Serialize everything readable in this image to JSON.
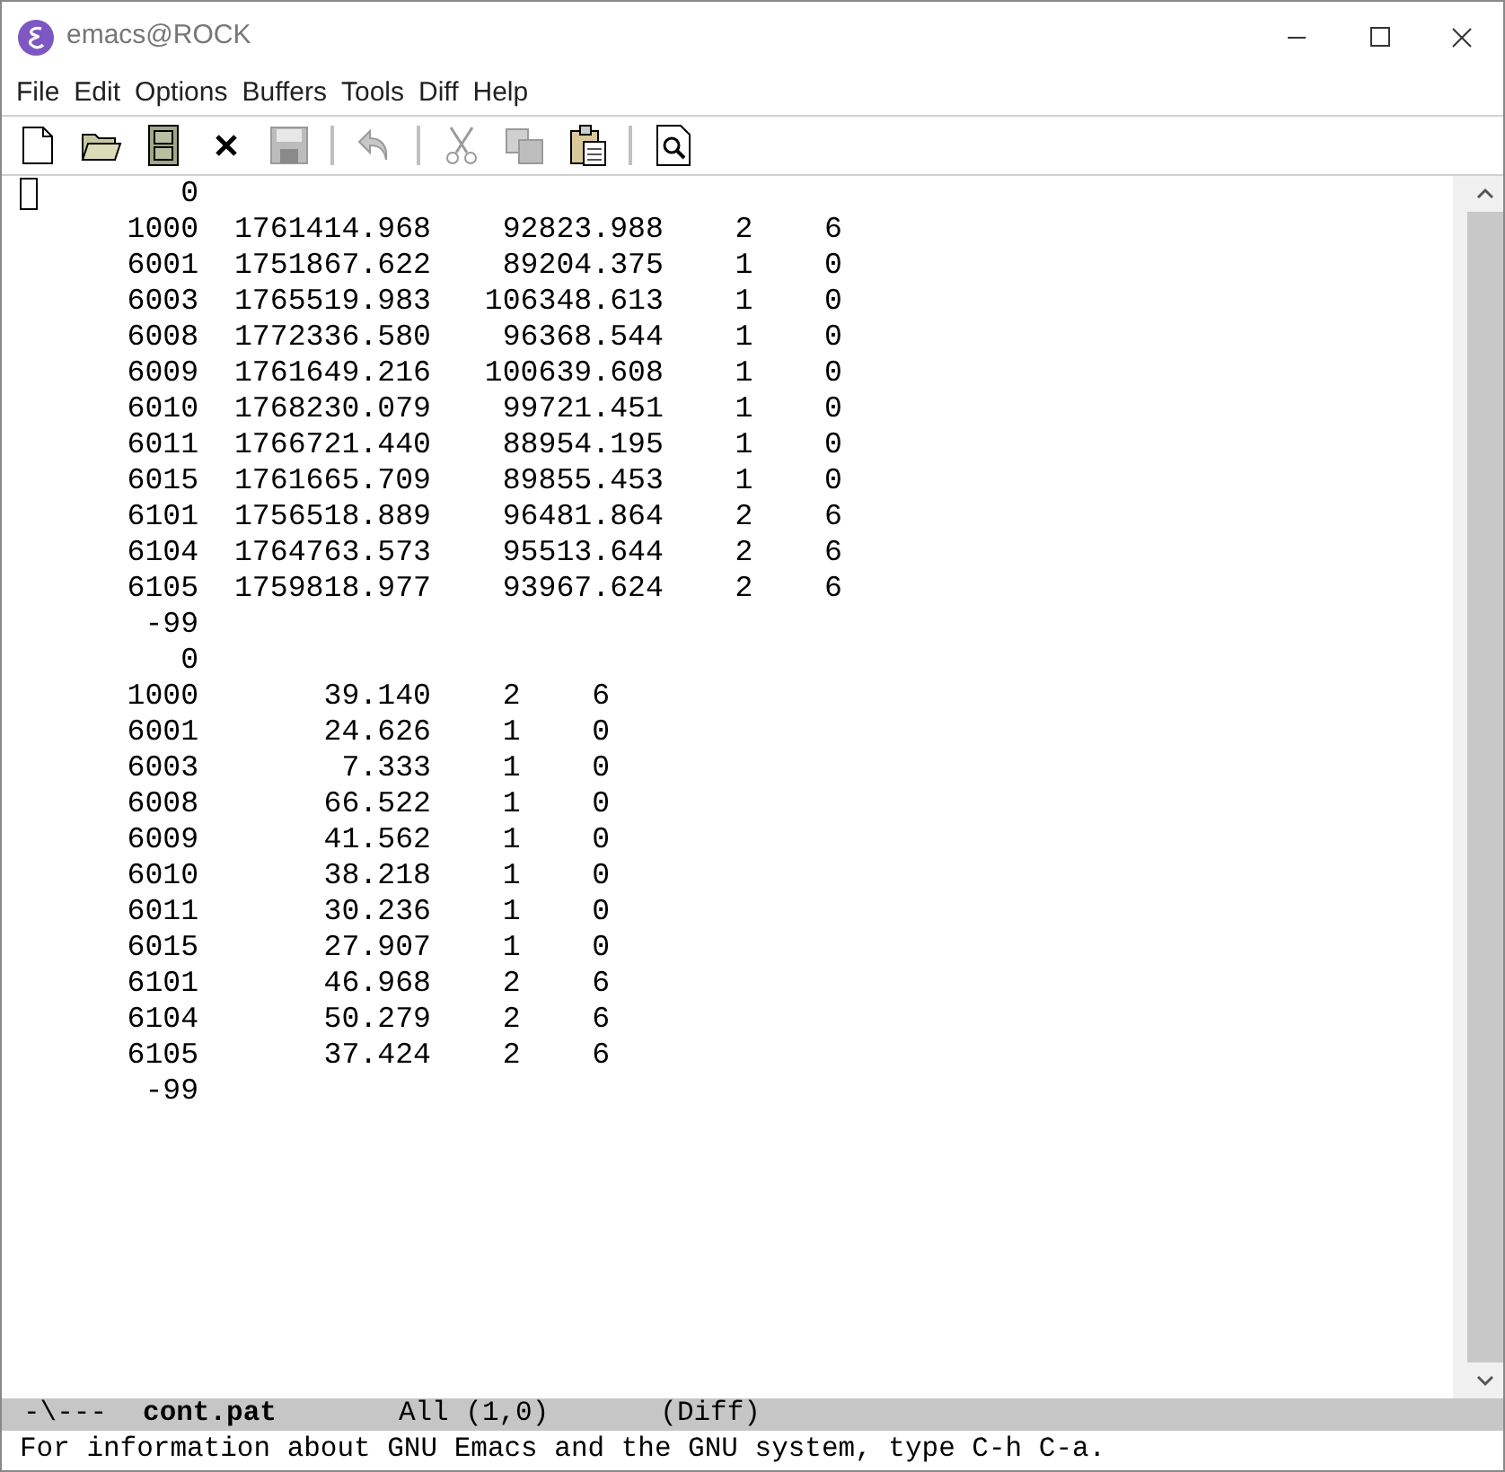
{
  "window": {
    "title": "emacs@ROCK"
  },
  "menu": [
    "File",
    "Edit",
    "Options",
    "Buffers",
    "Tools",
    "Diff",
    "Help"
  ],
  "toolbar": [
    {
      "kind": "new",
      "disabled": false
    },
    {
      "kind": "open",
      "disabled": false
    },
    {
      "kind": "dired",
      "disabled": false
    },
    {
      "kind": "close",
      "disabled": false
    },
    {
      "kind": "save",
      "disabled": true
    },
    {
      "kind": "sep"
    },
    {
      "kind": "undo",
      "disabled": true
    },
    {
      "kind": "sep"
    },
    {
      "kind": "cut",
      "disabled": true
    },
    {
      "kind": "copy",
      "disabled": true
    },
    {
      "kind": "paste",
      "disabled": false
    },
    {
      "kind": "sep"
    },
    {
      "kind": "search",
      "disabled": false
    }
  ],
  "buffer": {
    "rows": [
      {
        "kind": "marker",
        "cells": [
          "0"
        ]
      },
      {
        "kind": "coordinates",
        "cells": [
          "1000",
          "1761414.968",
          "92823.988",
          "2",
          "6"
        ]
      },
      {
        "kind": "coordinates",
        "cells": [
          "6001",
          "1751867.622",
          "89204.375",
          "1",
          "0"
        ]
      },
      {
        "kind": "coordinates",
        "cells": [
          "6003",
          "1765519.983",
          "106348.613",
          "1",
          "0"
        ]
      },
      {
        "kind": "coordinates",
        "cells": [
          "6008",
          "1772336.580",
          "96368.544",
          "1",
          "0"
        ]
      },
      {
        "kind": "coordinates",
        "cells": [
          "6009",
          "1761649.216",
          "100639.608",
          "1",
          "0"
        ]
      },
      {
        "kind": "coordinates",
        "cells": [
          "6010",
          "1768230.079",
          "99721.451",
          "1",
          "0"
        ]
      },
      {
        "kind": "coordinates",
        "cells": [
          "6011",
          "1766721.440",
          "88954.195",
          "1",
          "0"
        ]
      },
      {
        "kind": "coordinates",
        "cells": [
          "6015",
          "1761665.709",
          "89855.453",
          "1",
          "0"
        ]
      },
      {
        "kind": "coordinates",
        "cells": [
          "6101",
          "1756518.889",
          "96481.864",
          "2",
          "6"
        ]
      },
      {
        "kind": "coordinates",
        "cells": [
          "6104",
          "1764763.573",
          "95513.644",
          "2",
          "6"
        ]
      },
      {
        "kind": "coordinates",
        "cells": [
          "6105",
          "1759818.977",
          "93967.624",
          "2",
          "6"
        ]
      },
      {
        "kind": "marker",
        "cells": [
          "-99"
        ]
      },
      {
        "kind": "marker",
        "cells": [
          "0"
        ]
      },
      {
        "kind": "values",
        "cells": [
          "1000",
          "39.140",
          "2",
          "6"
        ]
      },
      {
        "kind": "values",
        "cells": [
          "6001",
          "24.626",
          "1",
          "0"
        ]
      },
      {
        "kind": "values",
        "cells": [
          "6003",
          "7.333",
          "1",
          "0"
        ]
      },
      {
        "kind": "values",
        "cells": [
          "6008",
          "66.522",
          "1",
          "0"
        ]
      },
      {
        "kind": "values",
        "cells": [
          "6009",
          "41.562",
          "1",
          "0"
        ]
      },
      {
        "kind": "values",
        "cells": [
          "6010",
          "38.218",
          "1",
          "0"
        ]
      },
      {
        "kind": "values",
        "cells": [
          "6011",
          "30.236",
          "1",
          "0"
        ]
      },
      {
        "kind": "values",
        "cells": [
          "6015",
          "27.907",
          "1",
          "0"
        ]
      },
      {
        "kind": "values",
        "cells": [
          "6101",
          "46.968",
          "2",
          "6"
        ]
      },
      {
        "kind": "values",
        "cells": [
          "6104",
          "50.279",
          "2",
          "6"
        ]
      },
      {
        "kind": "values",
        "cells": [
          "6105",
          "37.424",
          "2",
          "6"
        ]
      },
      {
        "kind": "marker",
        "cells": [
          "-99"
        ]
      }
    ]
  },
  "mode_line": {
    "status": "-\\---",
    "buffer_name": "cont.pat",
    "position": "All (1,0)",
    "mode": "(Diff)"
  },
  "echo_area": "For information about GNU Emacs and the GNU system, type C-h C-a."
}
